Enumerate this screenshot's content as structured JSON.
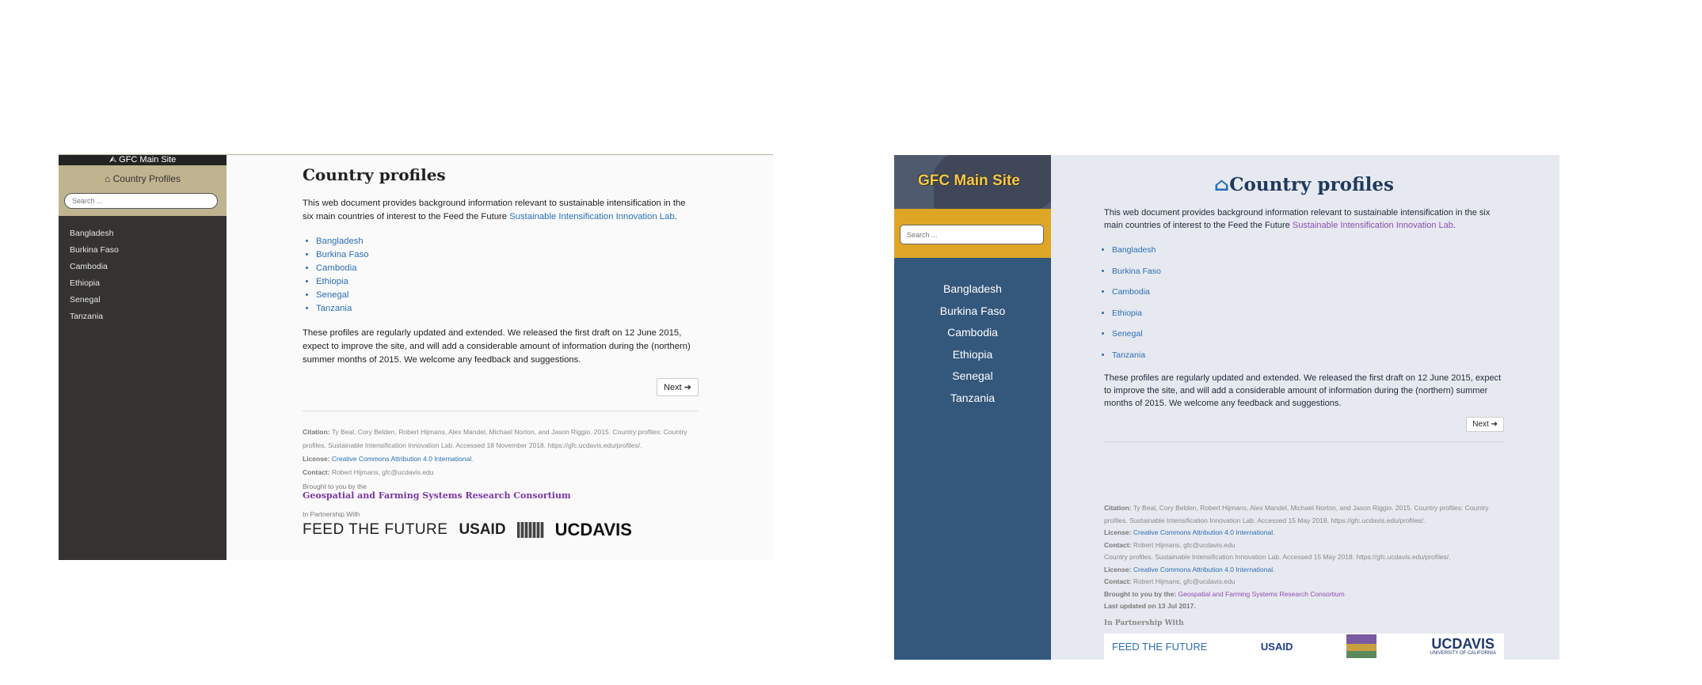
{
  "design_a": {
    "main_site": "GFC Main Site",
    "sidebar_title": "Country Profiles",
    "search_placeholder": "Search ...",
    "nav": [
      "Bangladesh",
      "Burkina Faso",
      "Cambodia",
      "Ethiopia",
      "Senegal",
      "Tanzania"
    ],
    "title": "Country profiles",
    "intro": "This web document provides background information relevant to sustainable intensification in the six main countries of interest to the Feed the Future ",
    "intro_link": "Sustainable Intensification Innovation Lab",
    "intro_end": ".",
    "countries": [
      "Bangladesh",
      "Burkina Faso",
      "Cambodia",
      "Ethiopia",
      "Senegal",
      "Tanzania"
    ],
    "updates": "These profiles are regularly updated and extended. We released the first draft on 12 June 2015, expect to improve the site, and will add a considerable amount of information during the (northern) summer months of 2015. We welcome any feedback and suggestions.",
    "next_label": "Next",
    "citation_label": "Citation:",
    "citation_text": "Ty Beal, Cory Belden, Robert Hijmans, Alex Mandel, Michael Norton, and Jason Riggio. 2015. Country profiles: Country profiles. Sustainable Intensification Innovation Lab. Accessed 18 November 2018. https://gfc.ucdavis.edu/profiles/.",
    "license_label": "License:",
    "license_link": "Creative Commons Attribution 4.0 International",
    "license_end": ".",
    "contact_label": "Contact:",
    "contact_text": "Robert Hijmans, gfc@ucdavis.edu",
    "brought_label": "Brought to you by the",
    "consortium": "Geospatial and Farming Systems Research Consortium",
    "partner_label": "In Partnership With",
    "logos": [
      "FEED THE FUTURE",
      "USAID",
      "UCDAVIS"
    ]
  },
  "design_b": {
    "main_site": "GFC Main Site",
    "search_placeholder": "Search ...",
    "nav": [
      "Bangladesh",
      "Burkina Faso",
      "Cambodia",
      "Ethiopia",
      "Senegal",
      "Tanzania"
    ],
    "title": "Country profiles",
    "intro": "This web document provides background information relevant to sustainable intensification in the six main countries of interest to the Feed the Future ",
    "intro_link": "Sustainable Intensification Innovation Lab",
    "intro_end": ".",
    "countries": [
      "Bangladesh",
      "Burkina Faso",
      "Cambodia",
      "Ethiopia",
      "Senegal",
      "Tanzania"
    ],
    "updates": "These profiles are regularly updated and extended. We released the first draft on 12 June 2015, expect to improve the site, and will add a considerable amount of information during the (northern) summer months of 2015. We welcome any feedback and suggestions.",
    "next_label": "Next",
    "citation_label": "Citation:",
    "citation_text": "Ty Beal, Cory Belden, Robert Hijmans, Alex Mandel, Michael Norton, and Jason Riggio. 2015. Country profiles: Country profiles. Sustainable Intensification Innovation Lab. Accessed 15 May 2018. https://gfc.ucdavis.edu/profiles/.",
    "license_label": "License:",
    "license_link": "Creative Commons Attribution 4.0 International",
    "license_end": ".",
    "contact_label": "Contact:",
    "contact_text": "Robert Hijmans, gfc@ucdavis.edu",
    "citation_text_2": "Country profiles. Sustainable Intensification Innovation Lab. Accessed 15 May 2018. https://gfc.ucdavis.edu/profiles/.",
    "license_label_2": "License:",
    "license_link_2": "Creative Commons Attribution 4.0 International",
    "license_end_2": ".",
    "contact_label_2": "Contact:",
    "contact_text_2": "Robert Hijmans, gfc@ucdavis.edu",
    "brought_label": "Brought to you by the:",
    "consortium": "Geospatial and Farming Systems Research Consortium",
    "updated_label": "Last updated on 13 Jul 2017.",
    "partner_label": "In Partnership With",
    "logos": [
      "FEED THE FUTURE",
      "USAID",
      "UCDAVIS",
      "UNIVERSITY OF CALIFORNIA"
    ]
  },
  "colors": {
    "a_sidebar": "#343331",
    "a_sidebar_head": "#c0b390",
    "b_sidebar": "#34577c",
    "b_search_band": "#dfa626",
    "b_background": "#e7e9f0",
    "link_blue": "#2a6fb4",
    "link_purple": "#8a4fb0"
  },
  "icons": [
    "circle-arrow-icon",
    "home-icon",
    "arrow-circle-right-icon"
  ]
}
